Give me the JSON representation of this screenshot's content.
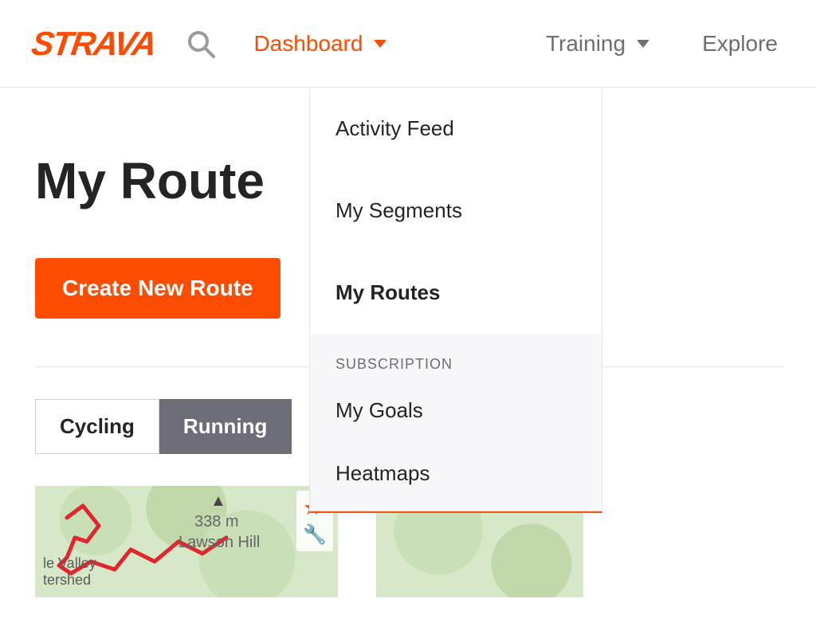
{
  "brand": "STRAVA",
  "nav": {
    "dashboard": "Dashboard",
    "training": "Training",
    "explore": "Explore"
  },
  "dropdown": {
    "items": [
      {
        "label": "Activity Feed"
      },
      {
        "label": "My Segments"
      },
      {
        "label": "My Routes"
      }
    ],
    "section_label": "SUBSCRIPTION",
    "subscription": [
      {
        "label": "My Goals"
      },
      {
        "label": "Heatmaps"
      }
    ]
  },
  "page": {
    "title": "My Route",
    "create_button": "Create New Route"
  },
  "tabs": {
    "cycling": "Cycling",
    "running": "Running"
  },
  "route_card": {
    "elevation": "338 m",
    "label1": "le Valley",
    "label2": "tershed",
    "hill": "Lawson Hill"
  }
}
